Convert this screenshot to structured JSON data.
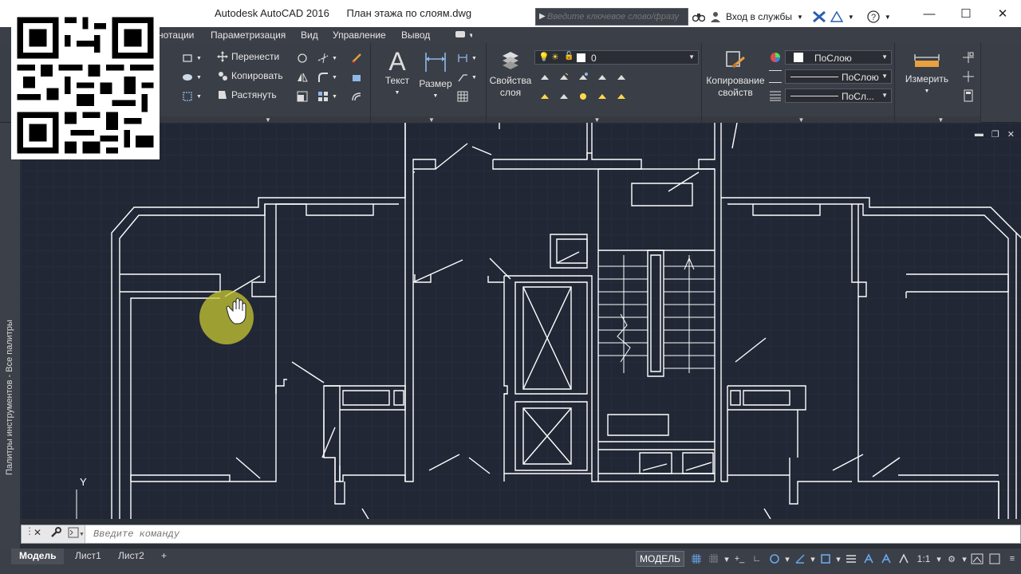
{
  "window": {
    "app_title": "Autodesk AutoCAD 2016",
    "file_name": "План этажа по слоям.dwg",
    "minimize": "—",
    "maximize": "☐",
    "close": "✕"
  },
  "search": {
    "placeholder": "Введите ключевое слово/фразу"
  },
  "header_tools": {
    "signin": "Вход в службы"
  },
  "menu": {
    "items": [
      "нотации",
      "Параметризация",
      "Вид",
      "Управление",
      "Вывод"
    ]
  },
  "ribbon": {
    "modify": {
      "move": "Перенести",
      "copy": "Копировать",
      "stretch": "Растянуть"
    },
    "annotation": {
      "text": "Текст",
      "dimension": "Размер"
    },
    "layers": {
      "props_line1": "Свойства",
      "props_line2": "слоя",
      "current_layer": "0"
    },
    "properties": {
      "match_line1": "Копирование",
      "match_line2": "свойств",
      "color": "ПоСлою",
      "linetype": "ПоСлою",
      "lineweight": "ПоСл..."
    },
    "utilities": {
      "measure": "Измерить"
    }
  },
  "palette": {
    "label": "Палитры инструментов - Все палитры"
  },
  "viewport": {
    "axis_label": "Y"
  },
  "command": {
    "placeholder": "Введите команду"
  },
  "status": {
    "tabs": [
      "Модель",
      "Лист1",
      "Лист2"
    ],
    "add_tab": "+",
    "model_button": "МОДЕЛЬ",
    "scale": "1:1"
  },
  "colors": {
    "drawing_bg": "#212735",
    "drawing_lines": "#ffffff",
    "cursor_highlight": "#c8c832",
    "ribbon_bg": "#3a3e46"
  }
}
